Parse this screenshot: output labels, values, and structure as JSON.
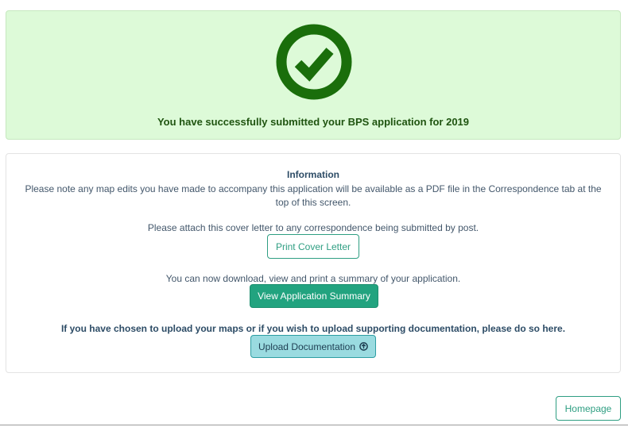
{
  "success": {
    "icon": "check-circle-icon",
    "message": "You have successfully submitted your BPS application for 2019",
    "color": "#1a6e0b"
  },
  "info": {
    "title": "Information",
    "map_note": "Please note any map edits you have made to accompany this application will be available as a PDF file in the Correspondence tab at the top of this screen.",
    "cover_letter_text": "Please attach this cover letter to any correspondence being submitted by post.",
    "print_cover_label": "Print Cover Letter",
    "summary_text": "You can now download, view and print a summary of your application.",
    "summary_label": "View Application Summary",
    "upload_text": "If you have chosen to upload your maps or if you wish to upload supporting documentation, please do so here.",
    "upload_label": "Upload Documentation",
    "upload_icon": "arrow-circle-up-icon"
  },
  "footer": {
    "homepage_label": "Homepage"
  }
}
